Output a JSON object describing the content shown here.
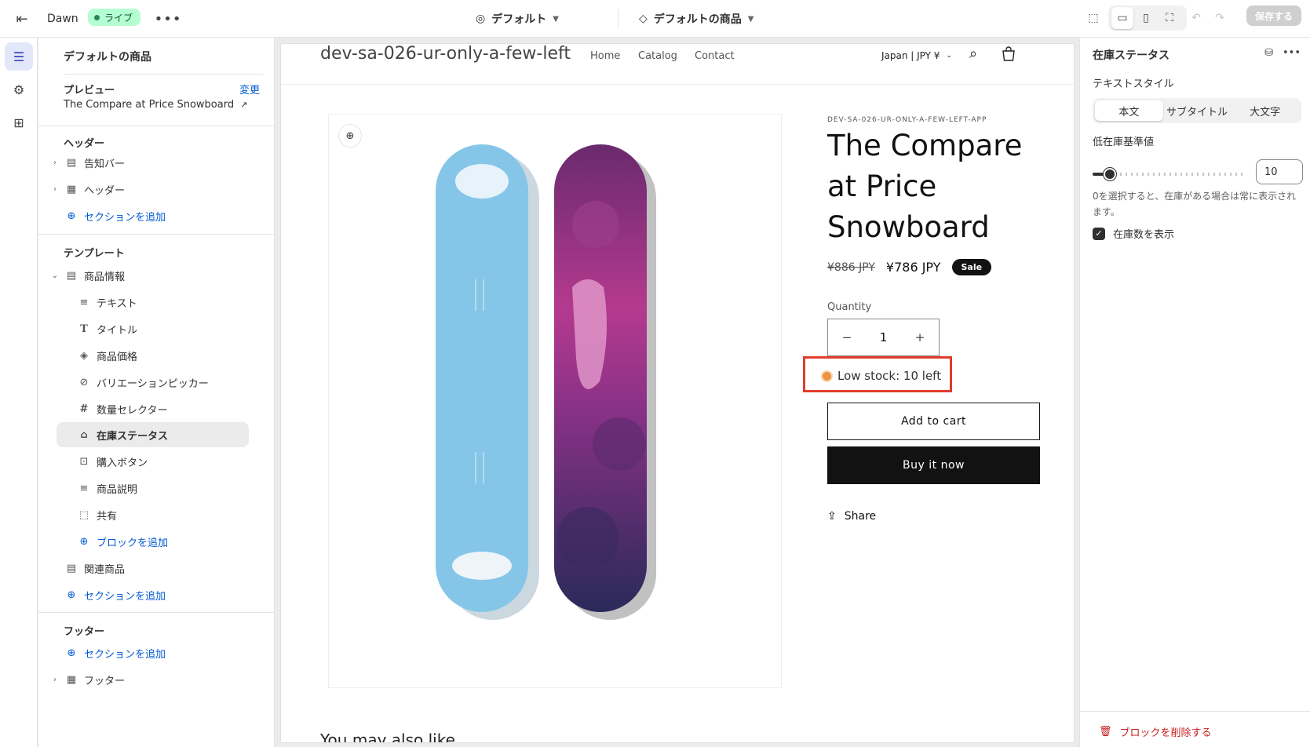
{
  "topbar": {
    "theme_name": "Dawn",
    "live_badge": "ライブ",
    "preset_dropdown": "デフォルト",
    "template_dropdown": "デフォルトの商品",
    "save_label": "保存する"
  },
  "left_panel": {
    "title": "デフォルトの商品",
    "preview_heading": "プレビュー",
    "change_link": "変更",
    "preview_product": "The Compare at Price Snowboard",
    "header_group": {
      "heading": "ヘッダー",
      "items": [
        "告知バー",
        "ヘッダー"
      ],
      "add_section": "セクションを追加"
    },
    "template_group": {
      "heading": "テンプレート",
      "section": "商品情報",
      "blocks": [
        "テキスト",
        "タイトル",
        "商品価格",
        "バリエーションピッカー",
        "数量セレクター",
        "在庫ステータス",
        "購入ボタン",
        "商品説明",
        "共有"
      ],
      "add_block": "ブロックを追加",
      "related": "関連商品",
      "add_section": "セクションを追加"
    },
    "footer_group": {
      "heading": "フッター",
      "add_section": "セクションを追加",
      "item": "フッター"
    }
  },
  "preview": {
    "store_name": "dev-sa-026-ur-only-a-few-left",
    "nav": [
      "Home",
      "Catalog",
      "Contact"
    ],
    "region": "Japan | JPY ¥",
    "vendor": "DEV-SA-026-UR-ONLY-A-FEW-LEFT-APP",
    "product_title": "The Compare at Price Snowboard",
    "price_old": "¥886 JPY",
    "price_new": "¥786 JPY",
    "sale_badge": "Sale",
    "quantity_label": "Quantity",
    "quantity_value": "1",
    "stock_text": "Low stock: 10 left",
    "add_to_cart": "Add to cart",
    "buy_now": "Buy it now",
    "share": "Share",
    "may_like": "You may also like"
  },
  "right_panel": {
    "title": "在庫ステータス",
    "text_style_label": "テキストスタイル",
    "text_style_options": [
      "本文",
      "サブタイトル",
      "大文字"
    ],
    "text_style_selected": "本文",
    "threshold_label": "低在庫基準値",
    "threshold_value": "10",
    "threshold_help": "0を選択すると、在庫がある場合は常に表示されます。",
    "show_count_label": "在庫数を表示",
    "show_count_checked": true,
    "delete_block": "ブロックを削除する"
  },
  "colors": {
    "accent_blue": "#005bd3",
    "live_green": "#29845a",
    "stock_orange": "#ee9441",
    "highlight_red": "#e03c2c",
    "delete_red": "#c81e1e"
  }
}
